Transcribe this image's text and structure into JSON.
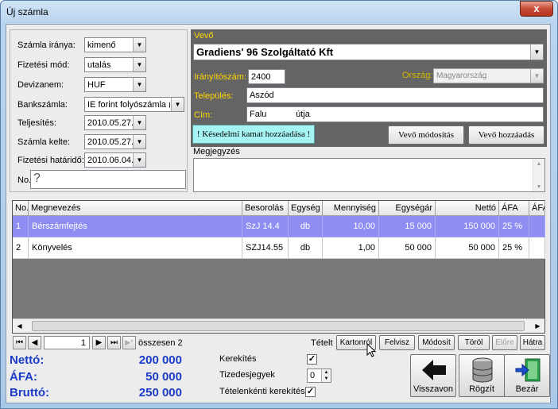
{
  "window": {
    "title": "Új számla",
    "close": "x"
  },
  "left": {
    "direction_label": "Számla iránya:",
    "direction_value": "kimenő",
    "payment_label": "Fizetési mód:",
    "payment_value": "utalás",
    "currency_label": "Devizanem:",
    "currency_value": "HUF",
    "bank_label": "Bankszámla:",
    "bank_value": "IE forint folyószámla (",
    "fulfil_label": "Teljesítés:",
    "fulfil_value": "2010.05.27.",
    "issue_label": "Számla kelte:",
    "issue_value": "2010.05.27.",
    "due_label": "Fizetési határidő:",
    "due_value": "2010.06.04.",
    "no_label": "No.",
    "no_value": "?"
  },
  "buyer": {
    "section_label": "Vevő",
    "name": "Gradiens' 96 Szolgáltató Kft",
    "zip_label": "Irányítószám:",
    "zip_value": "2400",
    "country_label": "Ország:",
    "country_value": "Magyarország",
    "city_label": "Település:",
    "city_value": "Aszód",
    "address_label": "Cím:",
    "address_value": "Falu            útja",
    "late_fee_button": "! Késedelmi kamat hozzáadása !",
    "modify_button": "Vevő módosítás",
    "add_button": "Vevő hozzáadás"
  },
  "note": {
    "label": "Megjegyzés",
    "value": ""
  },
  "table": {
    "columns": [
      "No.",
      "Megnevezés",
      "Besorolás",
      "Egység",
      "Mennyiség",
      "Egységár",
      "Nettó",
      "ÁFA",
      "ÁFA"
    ],
    "rows": [
      {
        "no": "1",
        "name": "Bérszámfejtés",
        "cls": "SzJ 14.4",
        "unit": "db",
        "qty": "10,00",
        "price": "15 000",
        "net": "150 000",
        "vat": "25 %",
        "selected": true
      },
      {
        "no": "2",
        "name": "Könyvelés",
        "cls": "SZJ14.55",
        "unit": "db",
        "qty": "1,00",
        "price": "50 000",
        "net": "50 000",
        "vat": "25 %",
        "selected": false
      }
    ]
  },
  "nav": {
    "first": "⏮",
    "prev": "◀",
    "page": "1",
    "next": "▶",
    "last": "⏭",
    "new": "▶*",
    "total": "összesen 2",
    "items_label": "Tételt",
    "from_card": "Kartonról",
    "add": "Felvisz",
    "modify": "Módosít",
    "delete": "Töröl",
    "forward": "Előre",
    "back": "Hátra"
  },
  "totals": {
    "net_label": "Nettó:",
    "net": "200 000",
    "vat_label": "ÁFA:",
    "vat": "50 000",
    "gross_label": "Bruttó:",
    "gross": "250 000"
  },
  "options": {
    "round_label": "Kerekítés",
    "round_checked": "✓",
    "decimals_label": "Tizedesjegyek",
    "decimals_value": "0",
    "item_round_label": "Tételenkénti kerekítés",
    "item_round_checked": "✓"
  },
  "actions": {
    "back": "Visszavon",
    "save": "Rögzít",
    "close": "Bezár"
  }
}
